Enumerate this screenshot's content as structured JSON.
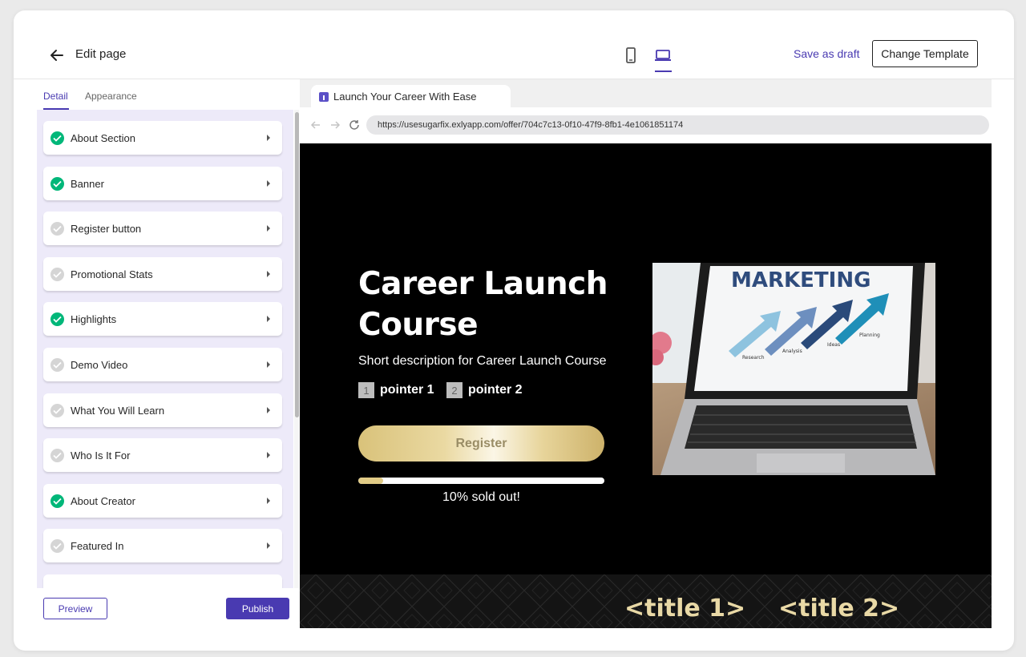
{
  "header": {
    "title": "Edit page",
    "save_draft": "Save as draft",
    "change_template": "Change Template"
  },
  "sidebar": {
    "tabs": [
      {
        "label": "Detail",
        "active": true
      },
      {
        "label": "Appearance",
        "active": false
      }
    ],
    "items": [
      {
        "label": "About Section",
        "done": true
      },
      {
        "label": "Banner",
        "done": true
      },
      {
        "label": "Register button",
        "done": false
      },
      {
        "label": "Promotional Stats",
        "done": false
      },
      {
        "label": "Highlights",
        "done": true
      },
      {
        "label": "Demo Video",
        "done": false
      },
      {
        "label": "What You Will Learn",
        "done": false
      },
      {
        "label": "Who Is It For",
        "done": false
      },
      {
        "label": "About Creator",
        "done": true
      },
      {
        "label": "Featured In",
        "done": false
      }
    ],
    "preview_label": "Preview",
    "publish_label": "Publish"
  },
  "browser": {
    "tab_title": "Launch Your Career With Ease",
    "url": "https://usesugarfix.exlyapp.com/offer/704c7c13-0f10-47f9-8fb1-4e1061851174"
  },
  "hero": {
    "title": "Career Launch Course",
    "description": "Short description for Career Launch Course",
    "pointers": [
      {
        "num": "1",
        "label": "pointer 1"
      },
      {
        "num": "2",
        "label": "pointer 2"
      }
    ],
    "register_label": "Register",
    "sold_percent": 10,
    "sold_text": "10% sold out!",
    "image_text": "MARKETING",
    "image_steps": [
      "Research",
      "Analysis",
      "Ideas",
      "Planning"
    ]
  },
  "band": {
    "titles": [
      "<title 1>",
      "<title 2>"
    ]
  },
  "colors": {
    "accent": "#493ab1",
    "done": "#00b779",
    "gold": "#e9d9a6"
  }
}
